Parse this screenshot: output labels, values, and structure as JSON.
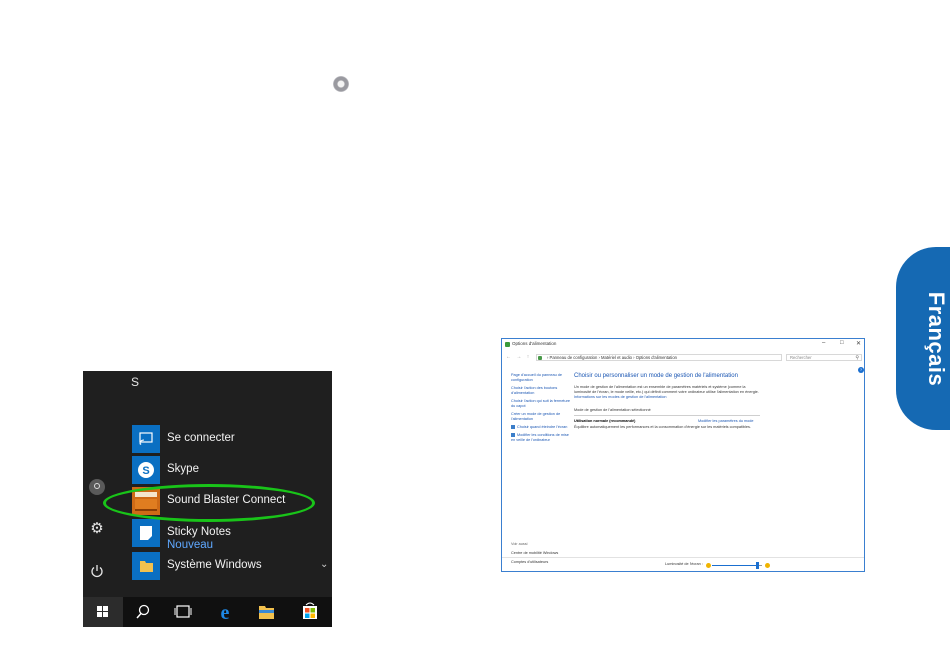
{
  "start_menu": {
    "section_letter": "S",
    "apps": [
      {
        "label": "Se connecter",
        "sub": ""
      },
      {
        "label": "Skype",
        "sub": ""
      },
      {
        "label": "Sound Blaster Connect",
        "sub": ""
      },
      {
        "label": "Sticky Notes",
        "sub": "Nouveau"
      },
      {
        "label": "Système Windows",
        "sub": ""
      }
    ],
    "taskbar_icons": [
      "windows-start-icon",
      "search-icon",
      "task-view-icon",
      "edge-icon",
      "file-explorer-icon",
      "store-icon"
    ],
    "highlight_color": "#19c419"
  },
  "language_tab": {
    "label": "Français",
    "color": "#1569b3"
  },
  "power_window": {
    "title": "Options d'alimentation",
    "breadcrumb": "› Panneau de configuration › Matériel et audio › Options d'alimentation",
    "search_placeholder": "Rechercher",
    "left_links": [
      "Page d'accueil du panneau de configuration",
      "Choisir l'action des boutons d'alimentation",
      "Choisir l'action qui suit la fermeture du capot",
      "Créer un mode de gestion de l'alimentation",
      "Choisir quand éteindre l'écran",
      "Modifier les conditions de mise en veille de l'ordinateur"
    ],
    "see_also": "Voir aussi",
    "see_also_links": [
      "Centre de mobilité Windows",
      "Comptes d'utilisateurs"
    ],
    "heading": "Choisir ou personnaliser un mode de gestion de l'alimentation",
    "description": "Un mode de gestion de l'alimentation est un ensemble de paramètres matériels et système (comme la luminosité de l'écran, le mode veille, etc.) qui définit comment votre ordinateur utilise l'alimentation en énergie.",
    "description_link": "Informations sur les modes de gestion de l'alimentation",
    "plans_label": "Mode de gestion de l'alimentation sélectionné",
    "plan_name": "Utilisation normale (recommandé)",
    "plan_link": "Modifier les paramètres du mode",
    "plan_desc": "Équilibre automatiquement les performances et la consommation d'énergie sur les matériels compatibles.",
    "brightness_label": "Luminosité de l'écran :",
    "brightness_level": 0.9
  }
}
